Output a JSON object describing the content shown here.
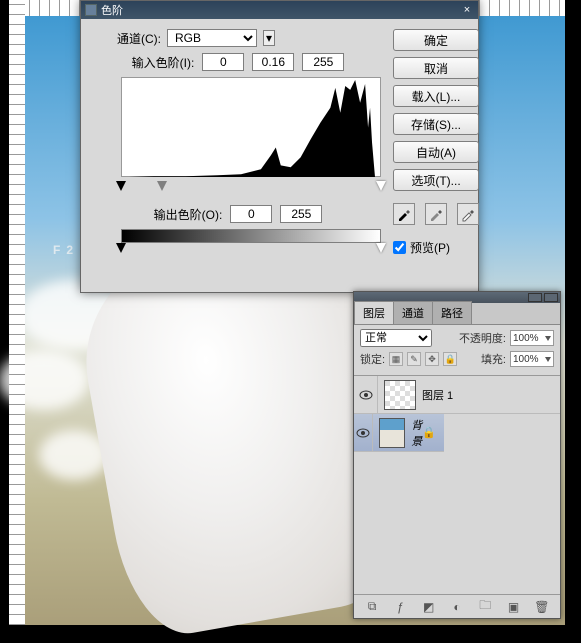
{
  "brand_text": "F2",
  "levels": {
    "title": "色阶",
    "channel_label": "通道(C):",
    "channel_value": "RGB",
    "input_label": "输入色阶(I):",
    "in_black": "0",
    "in_gamma": "0.16",
    "in_white": "255",
    "output_label": "输出色阶(O):",
    "out_black": "0",
    "out_white": "255",
    "buttons": {
      "ok": "确定",
      "cancel": "取消",
      "load": "载入(L)...",
      "save": "存储(S)...",
      "auto": "自动(A)",
      "options": "选项(T)..."
    },
    "preview_label": "预览(P)",
    "preview_checked": true
  },
  "layers": {
    "tabs": {
      "layers": "图层",
      "channels": "通道",
      "paths": "路径"
    },
    "blend_label": "正常",
    "opacity_label": "不透明度:",
    "opacity_value": "100%",
    "lock_label": "锁定:",
    "fill_label": "填充:",
    "fill_value": "100%",
    "items": [
      {
        "name": "图层 1",
        "selected": false,
        "thumb": "checker"
      },
      {
        "name": "背景",
        "selected": true,
        "thumb": "img",
        "locked": true
      }
    ]
  },
  "chart_data": {
    "type": "area",
    "title": "",
    "xlabel": "",
    "ylabel": "",
    "xlim": [
      0,
      255
    ],
    "ylim": [
      0,
      100
    ],
    "x": [
      0,
      32,
      64,
      96,
      120,
      140,
      150,
      155,
      160,
      170,
      180,
      190,
      200,
      210,
      215,
      220,
      225,
      230,
      235,
      240,
      245,
      248,
      250,
      252,
      255
    ],
    "values": [
      0,
      1,
      1,
      2,
      3,
      8,
      22,
      30,
      12,
      10,
      20,
      38,
      55,
      70,
      90,
      65,
      92,
      88,
      98,
      75,
      94,
      50,
      70,
      35,
      0
    ]
  }
}
